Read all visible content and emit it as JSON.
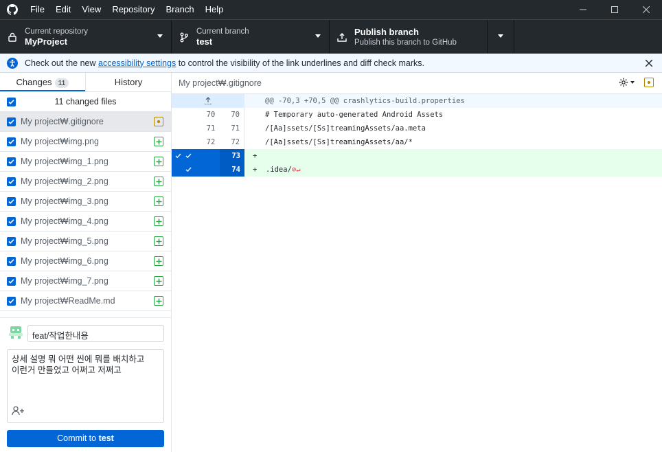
{
  "menu": [
    "File",
    "Edit",
    "View",
    "Repository",
    "Branch",
    "Help"
  ],
  "window_controls": {
    "minimize": "—",
    "maximize": "☐",
    "close": "✕"
  },
  "repo": {
    "label": "Current repository",
    "name": "MyProject"
  },
  "branch": {
    "label": "Current branch",
    "name": "test"
  },
  "publish": {
    "title": "Publish branch",
    "subtitle": "Publish this branch to GitHub"
  },
  "banner": {
    "before": "Check out the new ",
    "link": "accessibility settings",
    "after": " to control the visibility of the link underlines and diff check marks."
  },
  "tabs": {
    "changes": "Changes",
    "changes_count": "11",
    "history": "History"
  },
  "changes_header": "11 changed files",
  "files": [
    {
      "name": "My project₩.gitignore",
      "status": "modified",
      "selected": true
    },
    {
      "name": "My project₩img.png",
      "status": "added"
    },
    {
      "name": "My project₩img_1.png",
      "status": "added"
    },
    {
      "name": "My project₩img_2.png",
      "status": "added"
    },
    {
      "name": "My project₩img_3.png",
      "status": "added"
    },
    {
      "name": "My project₩img_4.png",
      "status": "added"
    },
    {
      "name": "My project₩img_5.png",
      "status": "added"
    },
    {
      "name": "My project₩img_6.png",
      "status": "added"
    },
    {
      "name": "My project₩img_7.png",
      "status": "added"
    },
    {
      "name": "My project₩ReadMe.md",
      "status": "added"
    }
  ],
  "commit": {
    "summary": "feat/작업한내용",
    "description_lines": [
      "상세 설명 뭐 어떤 씬에 뭐를 배치하고",
      "이런거 만들었고 어쩌고 저쩌고"
    ],
    "button_prefix": "Commit to ",
    "button_branch": "test"
  },
  "diff": {
    "path": "My project₩.gitignore",
    "hunk": "@@ -70,3 +70,5 @@ crashlytics-build.properties",
    "lines": [
      {
        "type": "context",
        "old": "70",
        "new": "70",
        "text": "# Temporary auto-generated Android Assets"
      },
      {
        "type": "context",
        "old": "71",
        "new": "71",
        "text": "/[Aa]ssets/[Ss]treamingAssets/aa.meta"
      },
      {
        "type": "context",
        "old": "72",
        "new": "72",
        "text": "/[Aa]ssets/[Ss]treamingAssets/aa/*"
      },
      {
        "type": "added",
        "old": "",
        "new": "73",
        "text": ""
      },
      {
        "type": "added",
        "old": "",
        "new": "74",
        "text": ".idea/"
      }
    ]
  },
  "colors": {
    "accent": "#0366d6",
    "added": "#28a745",
    "modified": "#b08800",
    "added_bg": "#e6ffed"
  }
}
